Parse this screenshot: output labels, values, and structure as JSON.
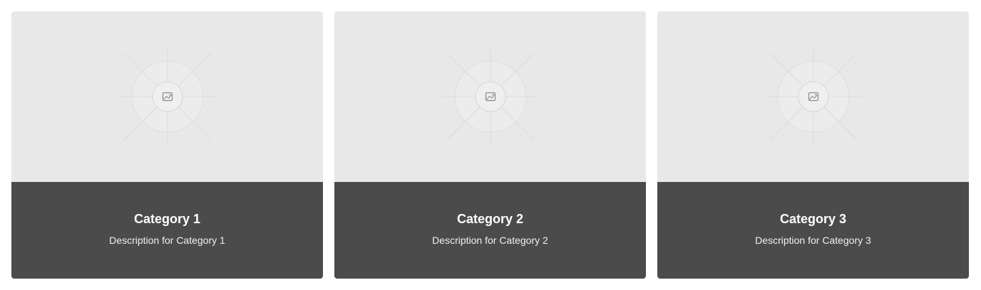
{
  "cards": [
    {
      "title": "Category 1",
      "description": "Description for Category 1",
      "image_icon": "image-placeholder-icon"
    },
    {
      "title": "Category 2",
      "description": "Description for Category 2",
      "image_icon": "image-placeholder-icon"
    },
    {
      "title": "Category 3",
      "description": "Description for Category 3",
      "image_icon": "image-placeholder-icon"
    }
  ],
  "colors": {
    "media_background": "#e8e8e8",
    "body_background": "#4b4b4b",
    "title_text": "#ffffff",
    "description_text": "#f0f0f0"
  }
}
